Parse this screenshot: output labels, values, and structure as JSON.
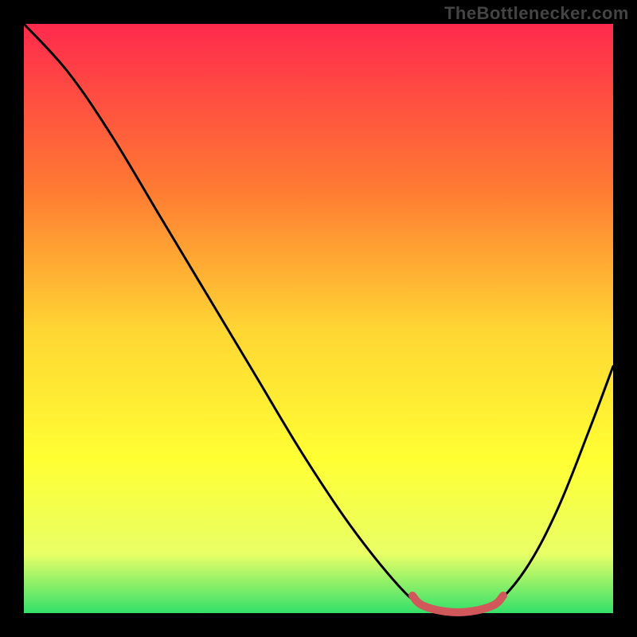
{
  "watermark": "TheBottlenecker.com",
  "colors": {
    "bg": "#000000",
    "grad_top": "#ff2a4d",
    "grad_upper_mid": "#ff7a33",
    "grad_mid": "#ffd633",
    "grad_lower_mid": "#ffff33",
    "grad_low": "#e8ff66",
    "grad_bottom": "#33e06b",
    "curve": "#000000",
    "marker": "#d1585a"
  },
  "chart_data": {
    "type": "line",
    "title": "",
    "xlabel": "",
    "ylabel": "",
    "xlim": [
      30,
      770
    ],
    "ylim": [
      770,
      30
    ],
    "note": "Percent-bottleneck–style V-curve. Lower is better; minimum marked with red segment near x≈530–620.",
    "series": [
      {
        "name": "bottleneck-curve",
        "points": [
          {
            "x": 30,
            "y": 30
          },
          {
            "x": 85,
            "y": 90
          },
          {
            "x": 140,
            "y": 170
          },
          {
            "x": 200,
            "y": 270
          },
          {
            "x": 260,
            "y": 370
          },
          {
            "x": 320,
            "y": 470
          },
          {
            "x": 380,
            "y": 570
          },
          {
            "x": 440,
            "y": 660
          },
          {
            "x": 500,
            "y": 735
          },
          {
            "x": 530,
            "y": 760
          },
          {
            "x": 560,
            "y": 768
          },
          {
            "x": 590,
            "y": 768
          },
          {
            "x": 620,
            "y": 760
          },
          {
            "x": 660,
            "y": 715
          },
          {
            "x": 700,
            "y": 640
          },
          {
            "x": 740,
            "y": 540
          },
          {
            "x": 770,
            "y": 460
          }
        ]
      }
    ],
    "marker_segment": {
      "points": [
        {
          "x": 518,
          "y": 748
        },
        {
          "x": 530,
          "y": 760
        },
        {
          "x": 560,
          "y": 768
        },
        {
          "x": 590,
          "y": 768
        },
        {
          "x": 620,
          "y": 760
        },
        {
          "x": 632,
          "y": 748
        }
      ]
    }
  }
}
